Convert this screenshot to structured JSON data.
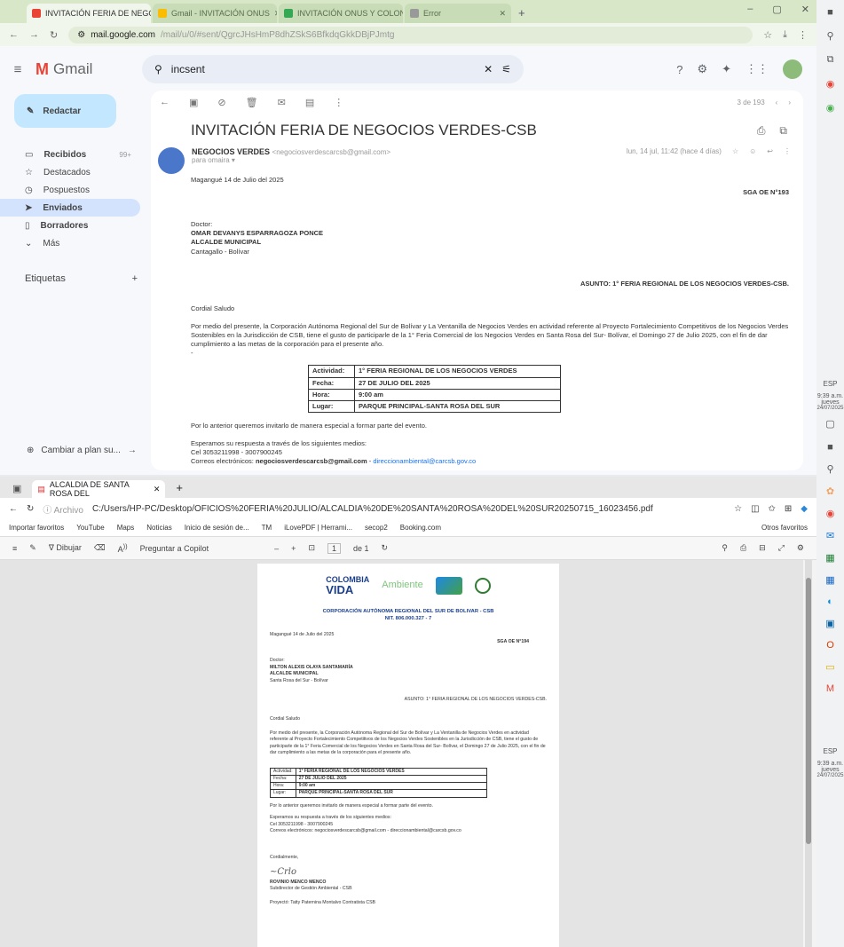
{
  "gmail_window": {
    "tabs": [
      {
        "label": "INVITACIÓN FERIA DE NEGOC",
        "color": "#ea4335"
      },
      {
        "label": "Gmail - INVITACIÓN ONUS",
        "color": "#fbbc04"
      },
      {
        "label": "INVITACIÓN ONUS Y COLONO",
        "color": "#34a853"
      },
      {
        "label": "Error",
        "color": "#999999"
      }
    ],
    "url": "mail.google.com",
    "url_path": "/mail/u/0/#sent/QgrcJHsHmP8dhZSkS6BfkdqGkkDBjPJmtg",
    "app_name": "Gmail",
    "search_value": "incsent",
    "compose_label": "Redactar",
    "nav": [
      {
        "label": "Recibidos",
        "count": "99+",
        "icon": "inbox-icon",
        "glyph": "▭"
      },
      {
        "label": "Destacados",
        "count": "",
        "icon": "star-icon",
        "glyph": "☆"
      },
      {
        "label": "Pospuestos",
        "count": "",
        "icon": "clock-icon",
        "glyph": "◷"
      },
      {
        "label": "Enviados",
        "count": "",
        "icon": "send-icon",
        "glyph": "➤"
      },
      {
        "label": "Borradores",
        "count": "",
        "icon": "draft-icon",
        "glyph": "▯"
      },
      {
        "label": "Más",
        "count": "",
        "icon": "chevron-down-icon",
        "glyph": "⌄"
      }
    ],
    "labels_title": "Etiquetas",
    "plan_label": "Cambiar a plan su...",
    "page_count": "3 de 193",
    "subject": "INVITACIÓN FERIA DE NEGOCIOS VERDES-CSB",
    "sender_name": "NEGOCIOS VERDES",
    "sender_email": "<negociosverdescarcsb@gmail.com>",
    "to": "para omaira",
    "date": "lun, 14 jul, 11:42 (hace 4 días)",
    "email": {
      "place_date": "Magangué 14 de Julio del 2025",
      "ref": "SGA OE N°193",
      "salutation_title": "Doctor:",
      "name": "OMAR DEVANYS ESPARRAGOZA PONCE",
      "role": "ALCALDE MUNICIPAL",
      "town": "Cantagallo - Bolívar",
      "asunto": "ASUNTO: 1° FERIA REGIONAL DE LOS NEGOCIOS VERDES-CSB.",
      "greeting": "Cordial Saludo",
      "paragraph": "Por medio del presente, la Corporación Autónoma Regional del Sur de Bolívar y La Ventanilla de Negocios Verdes en actividad referente al Proyecto Fortalecimiento Competitivos de los Negocios Verdes Sostenibles en la Jurisdicción de CSB, tiene el gusto de participarle de la 1° Feria Comercial de los Negocios Verdes en Santa Rosa del Sur- Bolívar, el Domingo 27 de Julio 2025, con el fin de dar cumplimiento a las metas de la corporación para el presente año.",
      "table": [
        {
          "k": "Actividad:",
          "v": "1° FERIA REGIONAL DE LOS NEGOCIOS VERDES"
        },
        {
          "k": "Fecha:",
          "v": "27 DE JULIO DEL 2025"
        },
        {
          "k": "Hora:",
          "v": "9:00 am"
        },
        {
          "k": "Lugar:",
          "v": "PARQUE PRINCIPAL-SANTA ROSA DEL SUR"
        }
      ],
      "invite": "Por lo anterior queremos invitarlo de manera especial a formar parte del evento.",
      "reply_line": "Esperamos su respuesta a través de los siguientes medios:",
      "phones": "Cel 3053211998 - 3007900245",
      "emails_label": "Correos electrónicos:",
      "email1": "negociosverdescarcsb@gmail.com",
      "email2": "direccionambiental@carcsb.gov.co"
    }
  },
  "edge_window": {
    "tab": "ALCALDIA DE SANTA ROSA DEL",
    "path_label": "Archivo",
    "path": "C:/Users/HP-PC/Desktop/OFICIOS%20FERIA%20JULIO/ALCALDIA%20DE%20SANTA%20ROSA%20DEL%20SUR20250715_16023456.pdf",
    "favorites": [
      "Importar favoritos",
      "YouTube",
      "Maps",
      "Noticias",
      "Inicio de sesión de...",
      "TM",
      "iLovePDF | Herrami...",
      "secop2",
      "Booking.com"
    ],
    "other_fav": "Otros favoritos",
    "pdf_draw": "Dibujar",
    "pdf_copilot": "Preguntar a Copilot",
    "pdf_page": "1",
    "pdf_of": "de 1",
    "letter": {
      "banner_colombia": "COLOMBIA",
      "banner_vida": "VIDA",
      "banner_ambiente": "Ambiente",
      "corp": "CORPORACIÓN AUTÓNOMA REGIONAL DEL SUR DE BOLIVAR - CSB",
      "nit": "NIT. 806.000.327 - 7",
      "place_date": "Magangué 14 de Julio del 2025",
      "ref": "SGA OE N°194",
      "salutation_title": "Doctor:",
      "name": "MILTON ALEXIS OLAYA SANTAMARÍA",
      "role": "ALCALDE MUNICIPAL",
      "town": "Santa Rosa del Sur - Bolívar",
      "asunto": "ASUNTO: 1° FERIA REGIONAL DE LOS NEGOCIOS VERDES-CSB.",
      "greeting": "Cordial Saludo",
      "paragraph": "Por medio del presente, la Corporación Autónoma Regional del Sur de Bolívar y La Ventanilla de Negocios Verdes en actividad referente al Proyecto Fortalecimiento Competitivos de los Negocios Verdes Sostenibles en la Jurisdicción de CSB, tiene el gusto de participarle de la 1° Feria Comercial de los Negocios Verdes en Santa Rosa del Sur- Bolívar, el Domingo 27 de Julio 2025, con el fin de dar cumplimiento a las metas de la corporación para el presente año.",
      "table": [
        {
          "k": "Actividad:",
          "v": "1° FERIA REGIONAL DE LOS NEGOCIOS VERDES"
        },
        {
          "k": "Fecha:",
          "v": "27 DE JULIO DEL 2025"
        },
        {
          "k": "Hora:",
          "v": "9:00 am"
        },
        {
          "k": "Lugar:",
          "v": "PARQUE PRINCIPAL-SANTA ROSA DEL SUR"
        }
      ],
      "invite": "Por lo anterior queremos invitarlo de manera especial a formar parte del evento.",
      "reply_line": "Esperamos su respuesta a través de los siguientes medios:",
      "phones": "Cel 3053211998 - 3007900245",
      "emails": "Correos electrónicos: negociosverdescarcsb@gmail.com - direccionambiental@carcsb.gov.co",
      "closing": "Cordialmente,",
      "signer": "ROVINIO MENCO MENCO",
      "signer_role": "Subdirector de Gestión Ambiental - CSB",
      "project": "Proyectó: Tatty Paternina Montalvo Contratista CSB"
    }
  },
  "taskbar": {
    "lang": "ESP",
    "time": "9:39 a.m.",
    "day": "jueves",
    "date": "24/07/2025"
  }
}
